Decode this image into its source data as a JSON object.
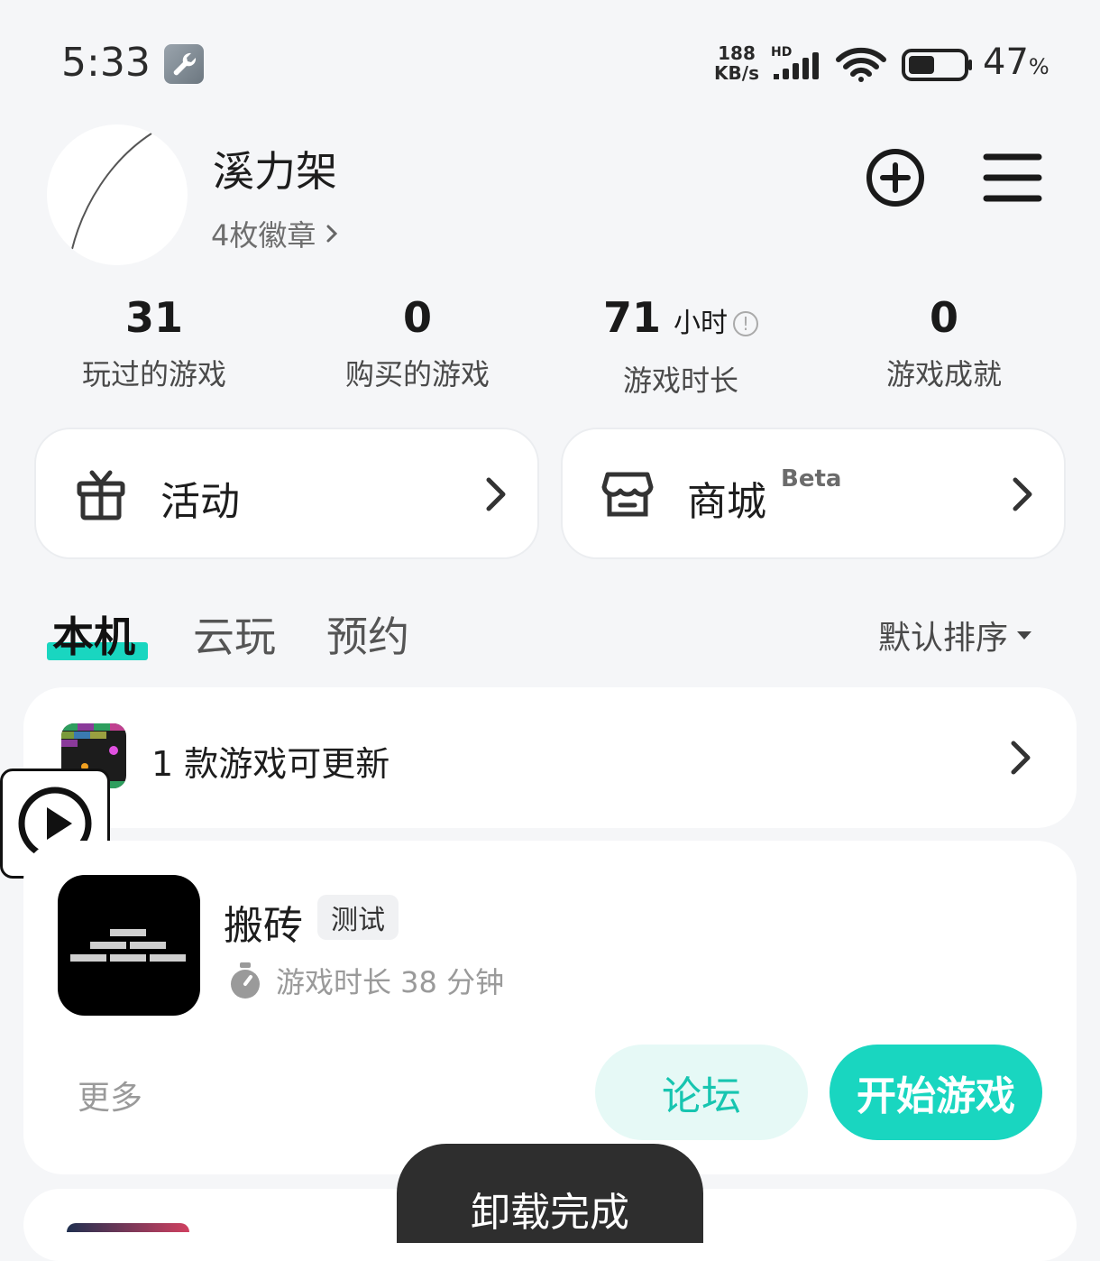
{
  "status_bar": {
    "time": "5:33",
    "speed_top": "188",
    "speed_bottom": "KB/s",
    "hd": "HD",
    "battery_pct": "47",
    "battery_unit": "%"
  },
  "profile": {
    "name": "溪力架",
    "badges": "4枚徽章"
  },
  "stats": [
    {
      "value": "31",
      "label": "玩过的游戏"
    },
    {
      "value": "0",
      "label": "购买的游戏"
    },
    {
      "value": "71",
      "unit": "小时",
      "label": "游戏时长"
    },
    {
      "value": "0",
      "label": "游戏成就"
    }
  ],
  "shortcuts": {
    "activity": "活动",
    "shop": "商城",
    "shop_tag": "Beta"
  },
  "tabs": [
    "本机",
    "云玩",
    "预约"
  ],
  "sort": "默认排序",
  "update_banner": "1 款游戏可更新",
  "game": {
    "name": "搬砖",
    "tag": "测试",
    "playtime": "游戏时长 38 分钟",
    "more": "更多",
    "forum": "论坛",
    "start": "开始游戏"
  },
  "toast": "卸载完成",
  "colors": {
    "accent": "#19d6c0",
    "background": "#f5f6f8"
  }
}
